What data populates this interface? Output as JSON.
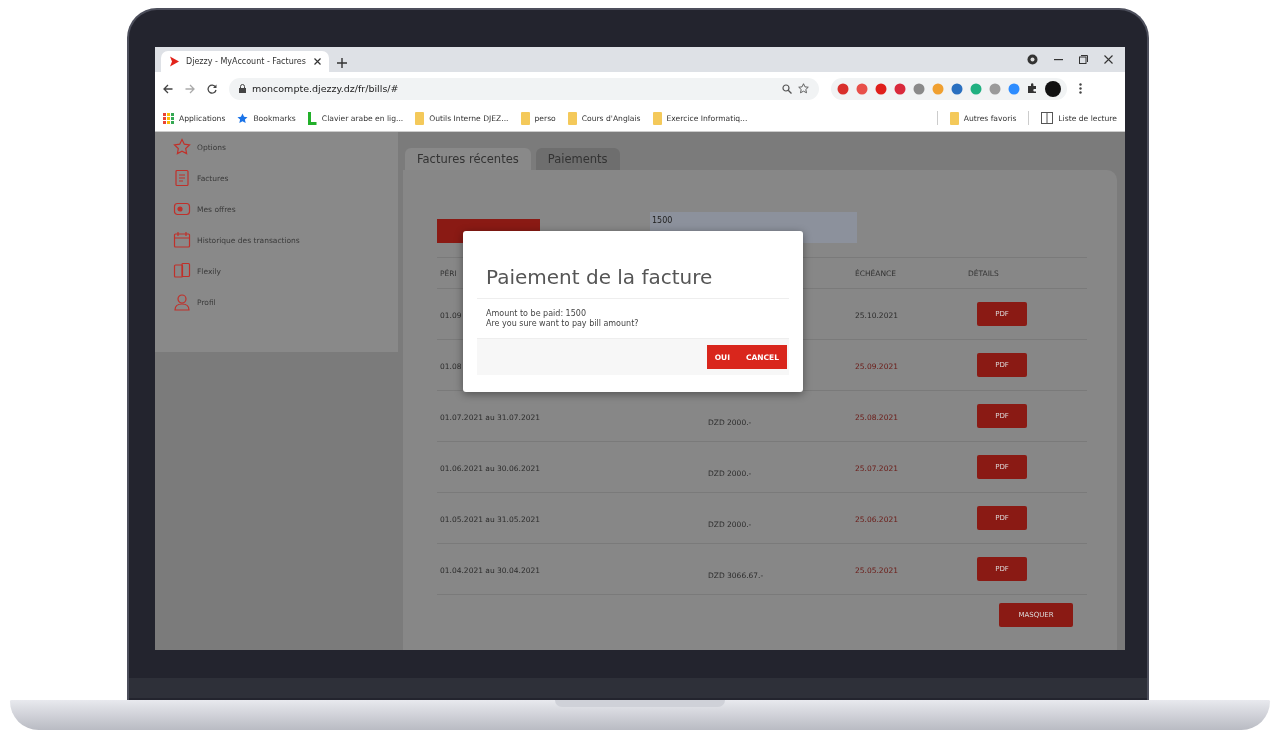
{
  "browser": {
    "tab_title": "Djezzy - MyAccount - Factures",
    "url": "moncompte.djezzy.dz/fr/bills/#",
    "bookmarks": [
      {
        "label": "Applications",
        "kind": "apps"
      },
      {
        "label": "Bookmarks",
        "kind": "star"
      },
      {
        "label": "Clavier arabe en lig...",
        "kind": "site"
      },
      {
        "label": "Outils Interne DJEZ...",
        "kind": "folder"
      },
      {
        "label": "perso",
        "kind": "folder"
      },
      {
        "label": "Cours d'Anglais",
        "kind": "folder"
      },
      {
        "label": "Exercice Informatiq...",
        "kind": "folder"
      }
    ],
    "bookmarks_right": [
      {
        "label": "Autres favoris",
        "kind": "folder"
      },
      {
        "label": "Liste de lecture",
        "kind": "reading"
      }
    ]
  },
  "sidebar": {
    "items": [
      {
        "label": "Options",
        "kind": "star"
      },
      {
        "label": "Factures",
        "kind": "bill"
      },
      {
        "label": "Mes offres",
        "kind": "offer"
      },
      {
        "label": "Historique des transactions",
        "kind": "calendar"
      },
      {
        "label": "Flexily",
        "kind": "phones"
      },
      {
        "label": "Profil",
        "kind": "person"
      }
    ]
  },
  "tabs": [
    {
      "label": "Factures récentes",
      "selected": true
    },
    {
      "label": "Paiements",
      "selected": false
    }
  ],
  "amount_field": {
    "value": "1500"
  },
  "table": {
    "period_heading": "PÉRI",
    "due_heading": "ÉCHÉANCE",
    "details_heading": "DÉTAILS",
    "rows": [
      {
        "period": "01.09",
        "due": "25.10.2021",
        "overdue": false,
        "button": "PDF"
      },
      {
        "period": "01.08",
        "due": "25.09.2021",
        "overdue": true,
        "button": "PDF"
      },
      {
        "period": "01.07.2021 au 31.07.2021",
        "amount": "DZD 2000.-",
        "due": "25.08.2021",
        "overdue": true,
        "button": "PDF"
      },
      {
        "period": "01.06.2021 au 30.06.2021",
        "amount": "DZD 2000.-",
        "due": "25.07.2021",
        "overdue": true,
        "button": "PDF"
      },
      {
        "period": "01.05.2021 au 31.05.2021",
        "amount": "DZD 2000.-",
        "due": "25.06.2021",
        "overdue": true,
        "button": "PDF"
      },
      {
        "period": "01.04.2021 au 30.04.2021",
        "amount": "DZD 3066.67.-",
        "due": "25.05.2021",
        "overdue": true,
        "button": "PDF"
      }
    ]
  },
  "hide_button": "MASQUER",
  "modal": {
    "title": "Paiement de la facture",
    "lines": [
      "Amount to be paid: 1500",
      "Are you sure want to pay bill amount?"
    ],
    "confirm": "OUI",
    "cancel": "CANCEL"
  }
}
